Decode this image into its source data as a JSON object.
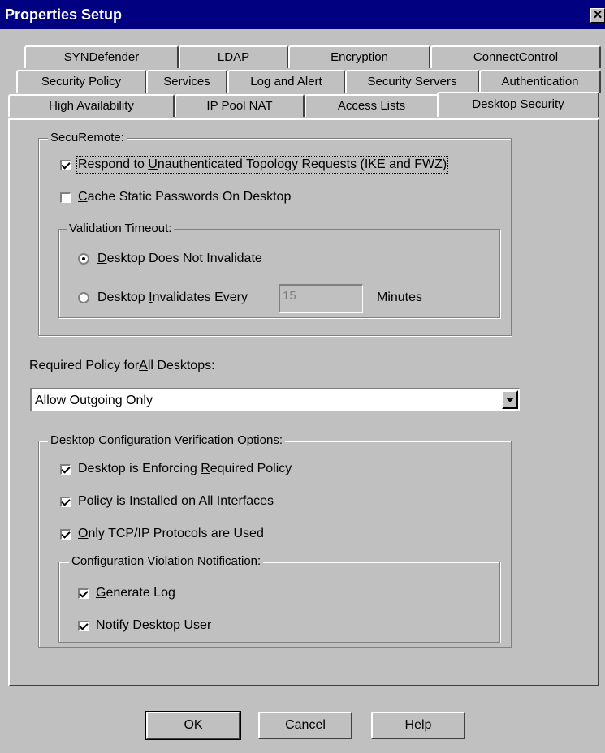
{
  "window": {
    "title": "Properties Setup"
  },
  "tabs": {
    "row1": [
      "SYNDefender",
      "LDAP",
      "Encryption",
      "ConnectControl"
    ],
    "row2": [
      "Security Policy",
      "Services",
      "Log and Alert",
      "Security Servers",
      "Authentication"
    ],
    "row3": [
      "High Availability",
      "IP Pool NAT",
      "Access Lists",
      "Desktop Security"
    ],
    "active": "Desktop Security"
  },
  "securemote": {
    "legend": "SecuRemote:",
    "respond_label_pre": "Respond to ",
    "respond_label_key": "U",
    "respond_label_post": "nauthenticated Topology Requests (IKE and FWZ)",
    "respond_checked": true,
    "cache_label_key": "C",
    "cache_label_post": "ache Static Passwords On Desktop",
    "cache_checked": false,
    "validation": {
      "legend": "Validation Timeout:",
      "not_invalidate_key": "D",
      "not_invalidate_post": "esktop Does Not Invalidate",
      "invalidates_pre": "Desktop ",
      "invalidates_key": "I",
      "invalidates_post": "nvalidates Every",
      "timeout_value": "15",
      "minutes_label": "Minutes",
      "selected": "not_invalidate"
    }
  },
  "required_policy": {
    "label_pre": "Required Policy for ",
    "label_key": "A",
    "label_post": "ll Desktops:",
    "selected": "Allow Outgoing Only"
  },
  "verification": {
    "legend": "Desktop Configuration Verification Options:",
    "enforcing_pre": "Desktop is Enforcing ",
    "enforcing_key": "R",
    "enforcing_post": "equired Policy",
    "enforcing_checked": true,
    "installed_key": "P",
    "installed_post": "olicy is Installed on All Interfaces",
    "installed_checked": true,
    "tcpip_key": "O",
    "tcpip_post": "nly TCP/IP Protocols are Used",
    "tcpip_checked": true,
    "notification": {
      "legend": "Configuration Violation Notification:",
      "log_key": "G",
      "log_post": "enerate Log",
      "log_checked": true,
      "notify_key": "N",
      "notify_post": "otify Desktop User",
      "notify_checked": true
    }
  },
  "buttons": {
    "ok": "OK",
    "cancel": "Cancel",
    "help": "Help"
  },
  "icons": {
    "close": "close-icon",
    "dropdown": "chevron-down-icon"
  },
  "colors": {
    "titlebar": "#000080",
    "face": "#c0c0c0"
  }
}
